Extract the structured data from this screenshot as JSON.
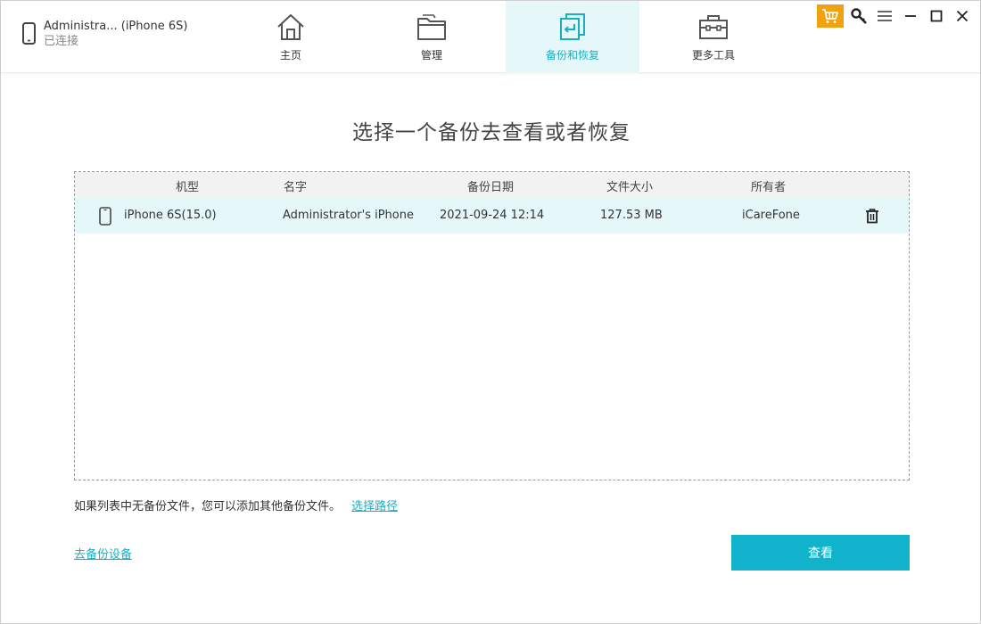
{
  "device": {
    "name": "Administra... (iPhone 6S)",
    "status": "已连接"
  },
  "tabs": [
    {
      "label": "主页",
      "icon": "home-icon",
      "active": false
    },
    {
      "label": "管理",
      "icon": "folder-icon",
      "active": false
    },
    {
      "label": "备份和恢复",
      "icon": "backup-restore-icon",
      "active": true
    },
    {
      "label": "更多工具",
      "icon": "toolbox-icon",
      "active": false
    }
  ],
  "system_buttons": [
    "cart-icon",
    "key-icon",
    "menu-icon",
    "minimize-icon",
    "maximize-icon",
    "close-icon"
  ],
  "heading": "选择一个备份去查看或者恢复",
  "table": {
    "headers": [
      "机型",
      "名字",
      "备份日期",
      "文件大小",
      "所有者"
    ],
    "rows": [
      {
        "model": "iPhone 6S(15.0)",
        "name": "Administrator's iPhone",
        "date": "2021-09-24 12:14",
        "size": "127.53 MB",
        "owner": "iCareFone"
      }
    ]
  },
  "hint": {
    "text": "如果列表中无备份文件，您可以添加其他备份文件。",
    "link": "选择路径"
  },
  "backup_link": "去备份设备",
  "view_button": "查看",
  "colors": {
    "accent": "#1aaec3",
    "button": "#10b3cb",
    "active_tab_bg": "#e6f7f9",
    "cart_bg": "#f2a20f"
  }
}
